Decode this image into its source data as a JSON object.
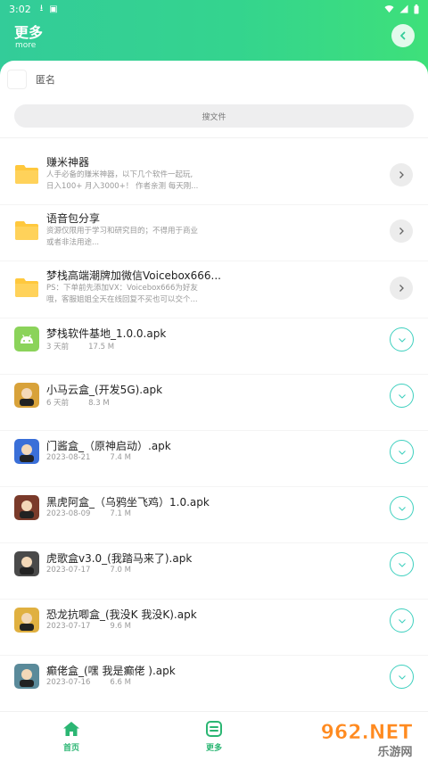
{
  "status_bar": {
    "time": "3:02"
  },
  "header": {
    "title": "更多",
    "subtitle": "more"
  },
  "user": {
    "name": "匿名"
  },
  "search": {
    "placeholder": "搜文件"
  },
  "items": [
    {
      "type": "folder",
      "name": "赚米神器",
      "desc1": "人手必备的赚米神器，以下几个软件一起玩,",
      "desc2": "日入100+ 月入3000+！ 作者亲测 每天刚..."
    },
    {
      "type": "folder",
      "name": "语音包分享",
      "desc1": "资源仅限用于学习和研究目的；不得用于商业",
      "desc2": "或者非法用途..."
    },
    {
      "type": "folder",
      "name": "梦栈高端潮牌加微信Voicebox666...",
      "desc1": "PS：下单前先添加VX：Voicebox666为好友",
      "desc2": "哦，客服姐姐全天在线回复不买也可以交个..."
    },
    {
      "type": "apk",
      "icon": "android-icon",
      "name": "梦栈软件基地_1.0.0.apk",
      "date": "3 天前",
      "size": "17.5 M"
    },
    {
      "type": "apk",
      "icon": "app-icon",
      "name": "小马云盒_(开发5G).apk",
      "date": "6 天前",
      "size": "8.3 M"
    },
    {
      "type": "apk",
      "icon": "app-icon",
      "name": "门酱盒_（原神启动）.apk",
      "date": "2023-08-21",
      "size": "7.4 M"
    },
    {
      "type": "apk",
      "icon": "app-icon",
      "name": "黑虎阿盒_（乌鸦坐飞鸡）1.0.apk",
      "date": "2023-08-09",
      "size": "7.1 M"
    },
    {
      "type": "apk",
      "icon": "app-icon",
      "name": "虎歌盒v3.0_(我踏马来了).apk",
      "date": "2023-07-17",
      "size": "7.0 M"
    },
    {
      "type": "apk",
      "icon": "app-icon",
      "name": "恐龙抗唧盒_(我没K 我没K).apk",
      "date": "2023-07-17",
      "size": "9.6 M"
    },
    {
      "type": "apk",
      "icon": "app-icon",
      "name": "癫佬盒_(嘿 我是癫佬 ).apk",
      "date": "2023-07-16",
      "size": "6.6 M"
    }
  ],
  "nav": {
    "home_label": "首页",
    "more_label": "更多"
  },
  "watermark": {
    "text": "962.NET",
    "sub": "乐游网"
  },
  "colors": {
    "accent": "#34d48e",
    "download_ring": "#3fd0bf",
    "folder": "#ffc83d",
    "android": "#8bd35a"
  }
}
